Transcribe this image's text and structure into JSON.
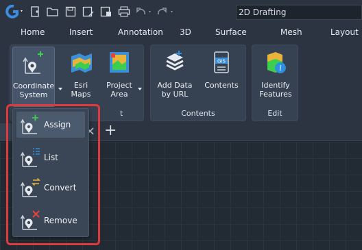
{
  "qat": {
    "workspace_value": "2D Drafting",
    "icons": [
      "app-logo-icon",
      "new-file-icon",
      "open-folder-icon",
      "save-icon",
      "save-as-icon",
      "save-all-icon",
      "print-icon",
      "undo-icon",
      "redo-icon"
    ]
  },
  "menu": {
    "tabs": [
      "Home",
      "Insert",
      "Annotation",
      "3D",
      "Surface",
      "Mesh",
      "Layout"
    ]
  },
  "ribbon": {
    "coordinate_system_line1": "Coordinate",
    "coordinate_system_line2": "System",
    "esri_maps_line1": "Esri",
    "esri_maps_line2": "Maps",
    "project_area_line1": "Project",
    "project_area_line2": "Area",
    "add_data_line1": "Add Data",
    "add_data_line2": "by URL",
    "contents_label": "Contents",
    "identify_line1": "Identify",
    "identify_line2": "Features",
    "panel_contents_title": "Contents",
    "panel_edit_title": "Edit",
    "panel_first_title_partial": "t",
    "panel_first_behind": "t"
  },
  "dropdown": {
    "items": [
      {
        "label": "Assign",
        "icon": "assign-icon"
      },
      {
        "label": "List",
        "icon": "list-icon"
      },
      {
        "label": "Convert",
        "icon": "convert-icon"
      },
      {
        "label": "Remove",
        "icon": "remove-icon"
      }
    ]
  },
  "docstrip": {
    "close_glyph": "×",
    "new_tab_glyph": "+"
  },
  "colors": {
    "highlight": "#e0393c",
    "accent_green": "#3ccf4e",
    "accent_blue": "#2d8fe0",
    "remove_red": "#e8433a"
  }
}
